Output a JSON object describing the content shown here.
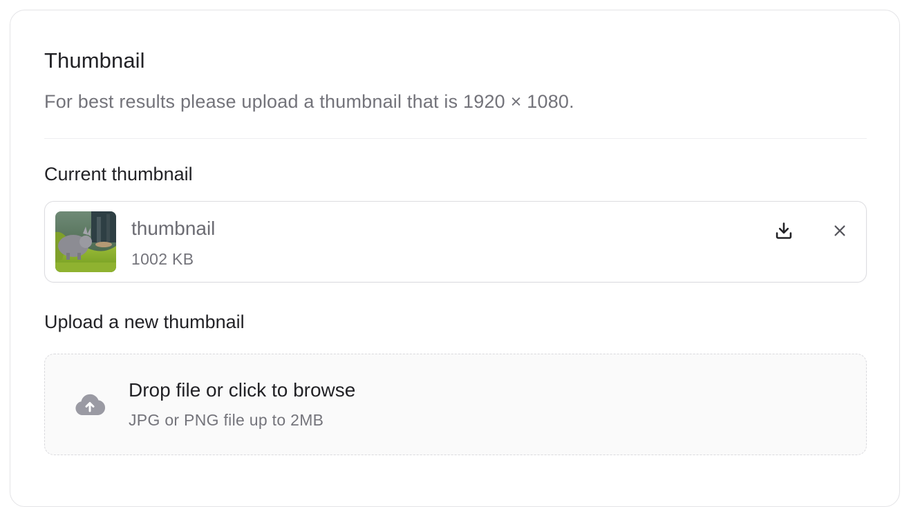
{
  "section": {
    "title": "Thumbnail",
    "subtitle": "For best results please upload a thumbnail that is 1920 × 1080."
  },
  "current": {
    "label": "Current thumbnail",
    "file": {
      "name": "thumbnail",
      "size": "1002 KB"
    },
    "actions": {
      "download_icon": "download-icon",
      "remove_icon": "close-icon"
    }
  },
  "upload": {
    "label": "Upload a new thumbnail",
    "dropzone": {
      "title": "Drop file or click to browse",
      "hint": "JPG or PNG file up to 2MB",
      "icon": "cloud-upload-icon"
    }
  },
  "colors": {
    "border": "#e3e3e6",
    "muted_text": "#73737a",
    "icon_gray": "#9a9aa3",
    "dropzone_bg": "#fafafa"
  }
}
